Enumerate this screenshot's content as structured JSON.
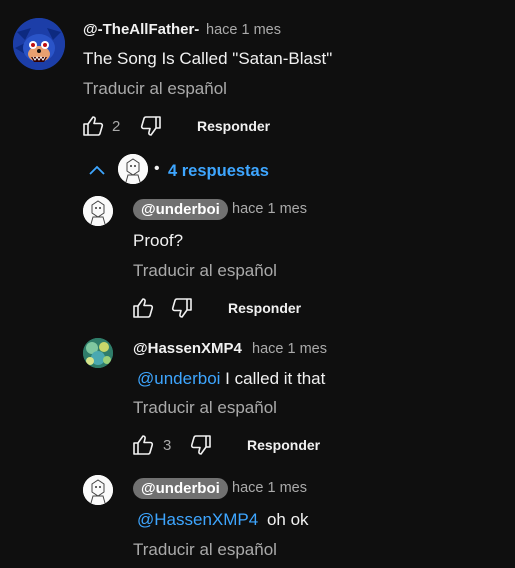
{
  "comment": {
    "author": "@-TheAllFather-",
    "time": "hace 1 mes",
    "text": "The Song Is Called \"Satan-Blast\"",
    "translate": "Traducir al español",
    "likes": "2",
    "reply_label": "Responder"
  },
  "thread": {
    "dot": "•",
    "replies_label": "4 respuestas"
  },
  "replies": [
    {
      "author": "@underboi",
      "time": "hace 1 mes",
      "text": "Proof?",
      "translate": "Traducir al español",
      "reply_label": "Responder"
    },
    {
      "author": "@HassenXMP4",
      "time": "hace 1 mes",
      "mention": "@underboi",
      "text": "I called it that",
      "translate": "Traducir al español",
      "likes": "3",
      "reply_label": "Responder"
    },
    {
      "author": "@underboi",
      "time": "hace 1 mes",
      "mention": "@HassenXMP4",
      "text": "oh ok",
      "translate": "Traducir al español"
    }
  ],
  "colors": {
    "background": "#0f0f0f",
    "link": "#3ea6ff",
    "secondary_text": "#aaaaaa",
    "pill": "#717171"
  }
}
